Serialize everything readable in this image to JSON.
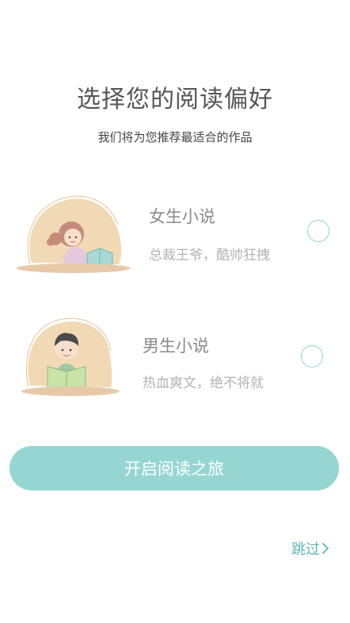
{
  "header": {
    "title": "选择您的阅读偏好",
    "subtitle": "我们将为您推荐最适合的作品"
  },
  "options": [
    {
      "id": "female",
      "title": "女生小说",
      "description": "总裁王爷，酷帅狂拽",
      "icon": "girl-reading-illustration",
      "selected": false
    },
    {
      "id": "male",
      "title": "男生小说",
      "description": "热血爽文，绝不将就",
      "icon": "boy-reading-illustration",
      "selected": false
    }
  ],
  "actions": {
    "start_label": "开启阅读之旅",
    "skip_label": "跳过",
    "skip_icon": "chevron-right-icon"
  },
  "colors": {
    "accent": "#95d6d2",
    "accent_text": "#5cb8b3",
    "title": "#555555",
    "option_title": "#8a8a8a",
    "option_desc": "#b3b3b3"
  }
}
